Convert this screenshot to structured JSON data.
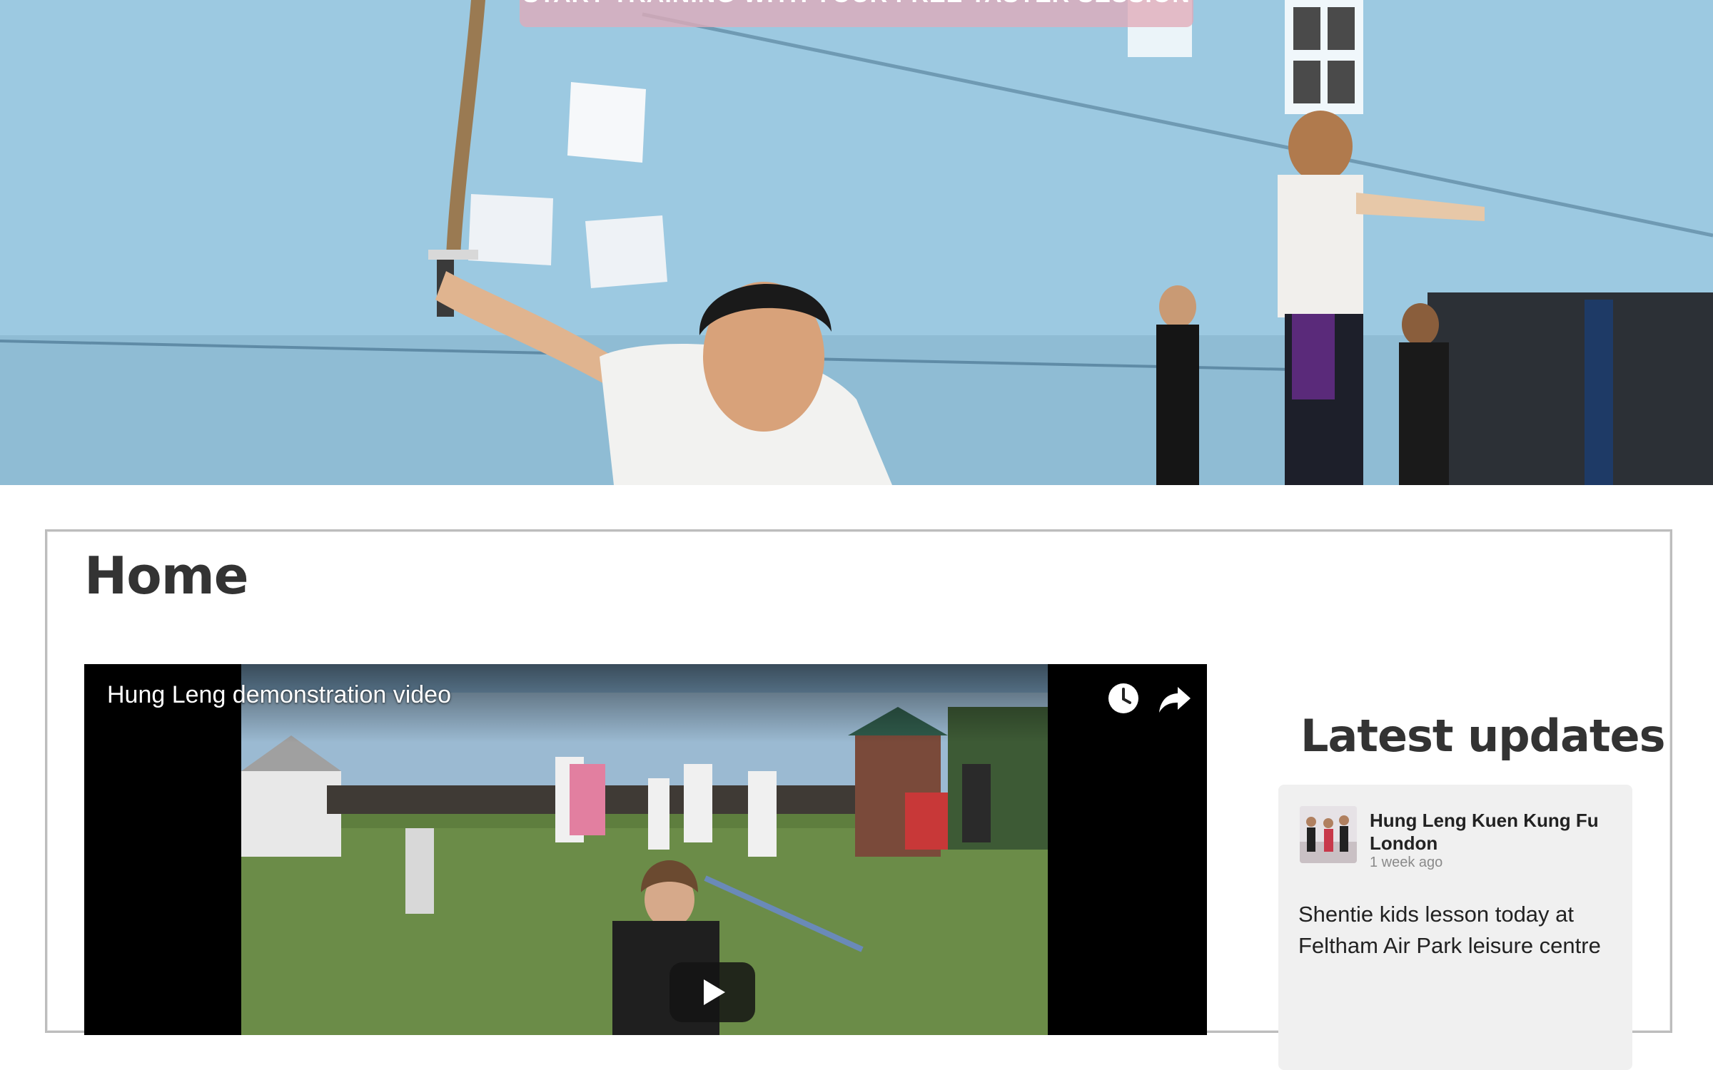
{
  "hero": {
    "cta_text": "START TRAINING WITH YOUR FREE TASTER SESSION"
  },
  "main": {
    "page_title": "Home",
    "video": {
      "title": "Hung Leng demonstration video",
      "icons": [
        "clock-icon",
        "share-icon",
        "play-icon"
      ]
    }
  },
  "sidebar": {
    "title": "Latest updates",
    "update": {
      "author": "Hung Leng Kuen Kung Fu London",
      "time": "1 week ago",
      "text": "Shentie kids lesson today at Feltham Air Park leisure centre"
    }
  },
  "colors": {
    "heading": "#333333",
    "card_bg": "#f0f0f0",
    "cta_bg": "#e0aab9",
    "hero_wall": "#9fcbe3"
  }
}
